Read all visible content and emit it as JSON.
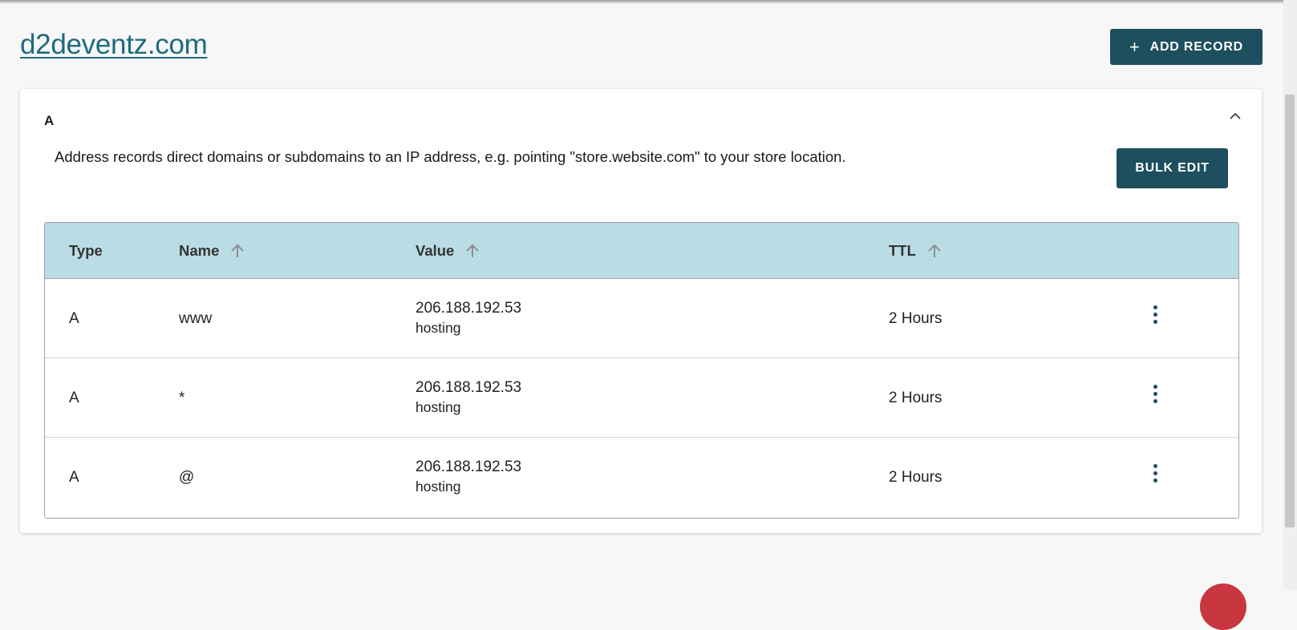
{
  "header": {
    "domain": "d2deventz.com",
    "add_record_label": "ADD RECORD"
  },
  "section": {
    "title": "A",
    "description": "Address records direct domains or subdomains to an IP address, e.g. pointing \"store.website.com\" to your store location.",
    "bulk_edit_label": "BULK EDIT"
  },
  "table": {
    "headers": {
      "type": "Type",
      "name": "Name",
      "value": "Value",
      "ttl": "TTL"
    },
    "rows": [
      {
        "type": "A",
        "name": "www",
        "value": "206.188.192.53",
        "value_note": "hosting",
        "ttl": "2 Hours"
      },
      {
        "type": "A",
        "name": "*",
        "value": "206.188.192.53",
        "value_note": "hosting",
        "ttl": "2 Hours"
      },
      {
        "type": "A",
        "name": "@",
        "value": "206.188.192.53",
        "value_note": "hosting",
        "ttl": "2 Hours"
      }
    ]
  },
  "icons": {
    "add": "plus-icon",
    "collapse": "chevron-up-icon",
    "sort": "arrow-up-icon",
    "row_menu": "more-vertical-icon"
  },
  "colors": {
    "primary": "#1d4f5e",
    "link": "#1d6b7e",
    "table_header_bg": "#badde5"
  }
}
